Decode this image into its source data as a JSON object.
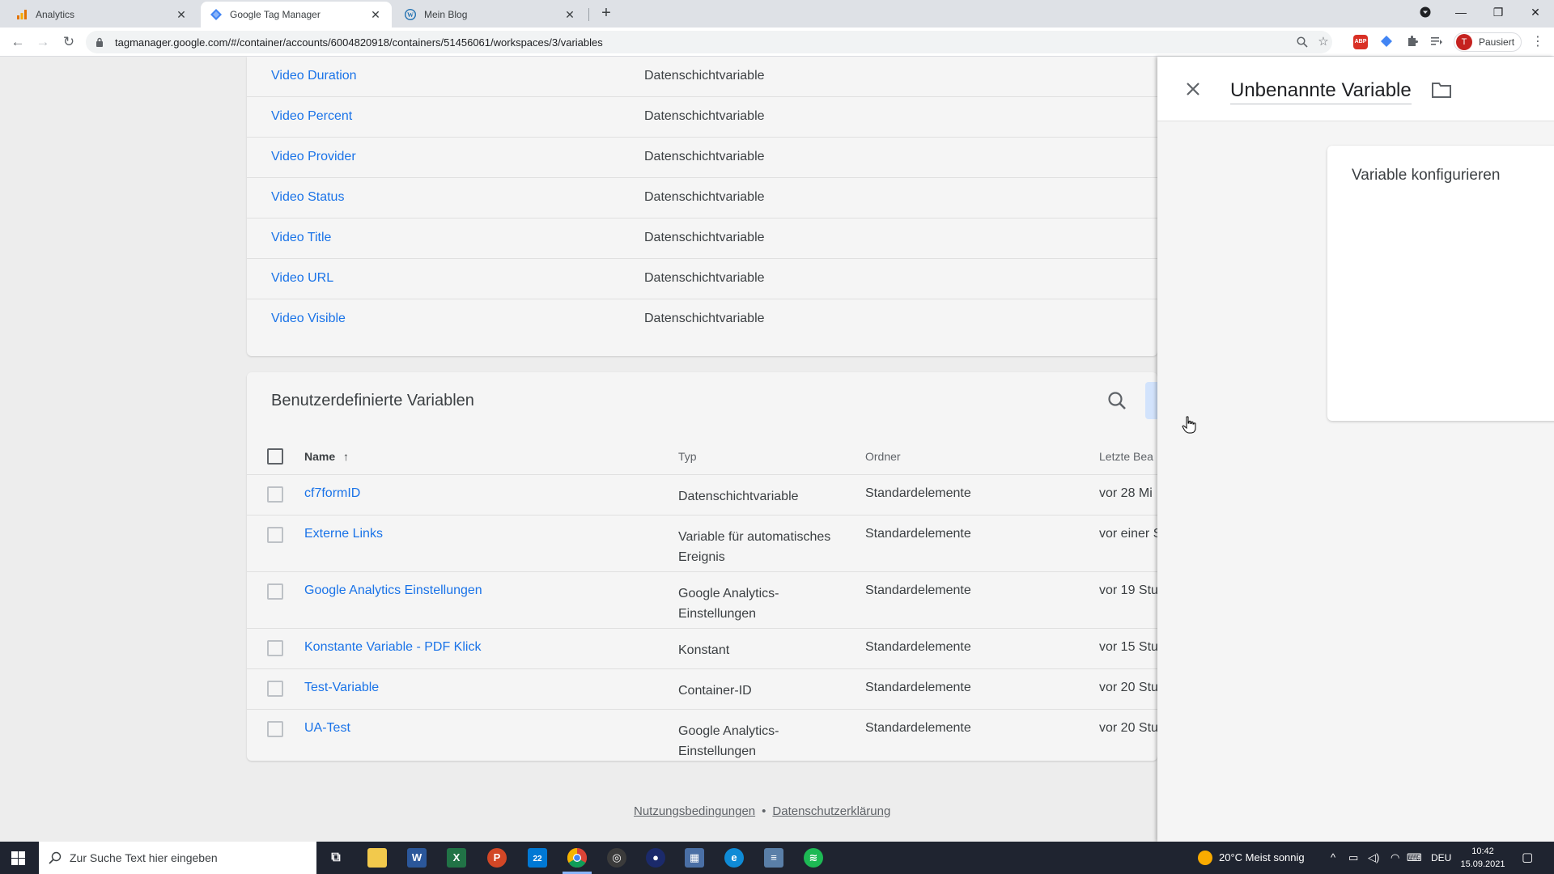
{
  "browser": {
    "tabs": [
      {
        "title": "Analytics"
      },
      {
        "title": "Google Tag Manager"
      },
      {
        "title": "Mein Blog"
      }
    ],
    "url": "tagmanager.google.com/#/container/accounts/6004820918/containers/51456061/workspaces/3/variables",
    "profile": {
      "initial": "T",
      "status": "Pausiert"
    }
  },
  "builtin_variables": [
    {
      "name": "Video Duration",
      "type": "Datenschichtvariable"
    },
    {
      "name": "Video Percent",
      "type": "Datenschichtvariable"
    },
    {
      "name": "Video Provider",
      "type": "Datenschichtvariable"
    },
    {
      "name": "Video Status",
      "type": "Datenschichtvariable"
    },
    {
      "name": "Video Title",
      "type": "Datenschichtvariable"
    },
    {
      "name": "Video URL",
      "type": "Datenschichtvariable"
    },
    {
      "name": "Video Visible",
      "type": "Datenschichtvariable"
    }
  ],
  "custom_variables": {
    "title": "Benutzerdefinierte Variablen",
    "columns": {
      "name": "Name",
      "type": "Typ",
      "folder": "Ordner",
      "last_edited": "Letzte Bea"
    },
    "rows": [
      {
        "name": "cf7formID",
        "type": "Datenschichtvariable",
        "folder": "Standardelemente",
        "edited": "vor 28 Mi"
      },
      {
        "name": "Externe Links",
        "type": "Variable für automatisches Ereignis",
        "folder": "Standardelemente",
        "edited": "vor einer S"
      },
      {
        "name": "Google Analytics Einstellungen",
        "type": "Google Analytics-Einstellungen",
        "folder": "Standardelemente",
        "edited": "vor 19 Stu"
      },
      {
        "name": "Konstante Variable - PDF Klick",
        "type": "Konstant",
        "folder": "Standardelemente",
        "edited": "vor 15 Stu"
      },
      {
        "name": "Test-Variable",
        "type": "Container-ID",
        "folder": "Standardelemente",
        "edited": "vor 20 Stu"
      },
      {
        "name": "UA-Test",
        "type": "Google Analytics-Einstellungen",
        "folder": "Standardelemente",
        "edited": "vor 20 Stu"
      }
    ]
  },
  "footer": {
    "terms": "Nutzungsbedingungen",
    "separator": "•",
    "privacy": "Datenschutzerklärung"
  },
  "panel": {
    "variable_name": "Unbenannte Variable",
    "config_title": "Variable konfigurieren"
  },
  "taskbar": {
    "search_placeholder": "Zur Suche Text hier eingeben",
    "mail_badge": "22",
    "weather": "20°C  Meist sonnig",
    "language": "DEU",
    "time": "10:42",
    "date": "15.09.2021"
  },
  "colors": {
    "link": "#1a73e8",
    "accent_light": "#d2e3fc",
    "taskbar": "#1f2430"
  }
}
